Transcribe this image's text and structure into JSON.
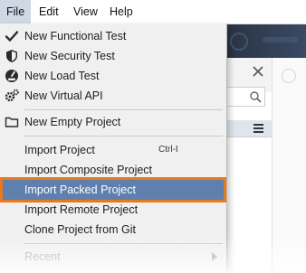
{
  "menubar": {
    "items": [
      {
        "label": "File"
      },
      {
        "label": "Edit"
      },
      {
        "label": "View"
      },
      {
        "label": "Help"
      }
    ]
  },
  "file_menu": {
    "new_functional_test": "New Functional Test",
    "new_security_test": "New Security Test",
    "new_load_test": "New Load Test",
    "new_virtual_api": "New Virtual API",
    "new_empty_project": "New Empty Project",
    "import_project": "Import Project",
    "import_project_shortcut": "Ctrl-I",
    "import_composite_project": "Import Composite Project",
    "import_packed_project": "Import Packed Project",
    "import_remote_project": "Import Remote Project",
    "clone_project_from_git": "Clone Project from Git",
    "recent": "Recent",
    "highlighted_item": "Import Packed Project"
  },
  "colors": {
    "highlight_fill": "#5f7fac",
    "highlight_outline": "#e87a1e",
    "active_menu": "#cfd8e4"
  },
  "icons": [
    "checkmark-icon",
    "shield-icon",
    "gauge-icon",
    "gears-icon",
    "folder-icon",
    "close-icon",
    "search-icon",
    "hamburger-icon",
    "submenu-arrow-icon"
  ]
}
